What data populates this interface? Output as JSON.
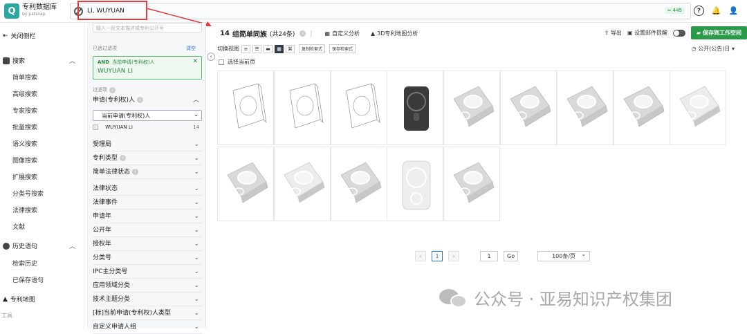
{
  "app": {
    "name": "专利数据库",
    "by": "by patsnap",
    "logo_letter": "Q"
  },
  "search": {
    "value": "LI, WUYUAN",
    "count": "≈ 445"
  },
  "top_icons": [
    "help-icon",
    "bell-icon",
    "user-icon"
  ],
  "sidebar": {
    "close_label": "关闭侧栏",
    "search_head": "搜索",
    "search_items": [
      "简单搜索",
      "高级搜索",
      "专家搜索",
      "批量搜索",
      "语义搜索",
      "图像搜索",
      "扩展搜索",
      "分类号搜索",
      "法律搜索",
      "文献"
    ],
    "history_head": "历史语句",
    "history_items": [
      "检索历史",
      "已保存语句"
    ],
    "map_head": "专利地图",
    "tools_label": "工具"
  },
  "filter": {
    "input_placeholder": "输入一段文本描述或专利公开号",
    "applied_label": "已选过滤项",
    "clear_label": "清空",
    "chip_and": "AND",
    "chip_field": "当前申请(专利权)人",
    "chip_value": "WUYUAN LI",
    "filters_label": "过滤项",
    "applicant_title": "申请(专利权)人",
    "applicant_select": "当前申请(专利权)人",
    "applicant_option": "WUYUAN LI",
    "applicant_count": "14",
    "rows": [
      "受理局",
      "专利类型",
      "简单法律状态",
      "法律状态",
      "法律事件",
      "申请年",
      "公开年",
      "授权年",
      "分类号",
      "IPC主分类号",
      "应用领域分类",
      "技术主题分类",
      "[标]当前申请(专利权)人类型",
      "自定义申请人组"
    ]
  },
  "results": {
    "count": "14",
    "family_label": "组简单同族",
    "total": "(共24条)",
    "custom_analysis": "自定义分析",
    "map_analysis": "3D专利地图分析",
    "export": "导出",
    "email_alert": "设置邮件提醒",
    "save_to": "保存到工作空间",
    "view_label": "切换视图",
    "copy_style": "复制检索式",
    "save_style": "保存检索式",
    "sort": "公开(公告)日",
    "select_page": "选择当前页",
    "colors": {
      "accent": "#2a9a4a",
      "link": "#2b6fcf"
    }
  },
  "pager": {
    "prev": "‹",
    "page": "1",
    "next": "›",
    "jump": "1",
    "go": "Go",
    "per_page": "100条/页"
  },
  "watermark": "公众号 · 亚易知识产权集团"
}
